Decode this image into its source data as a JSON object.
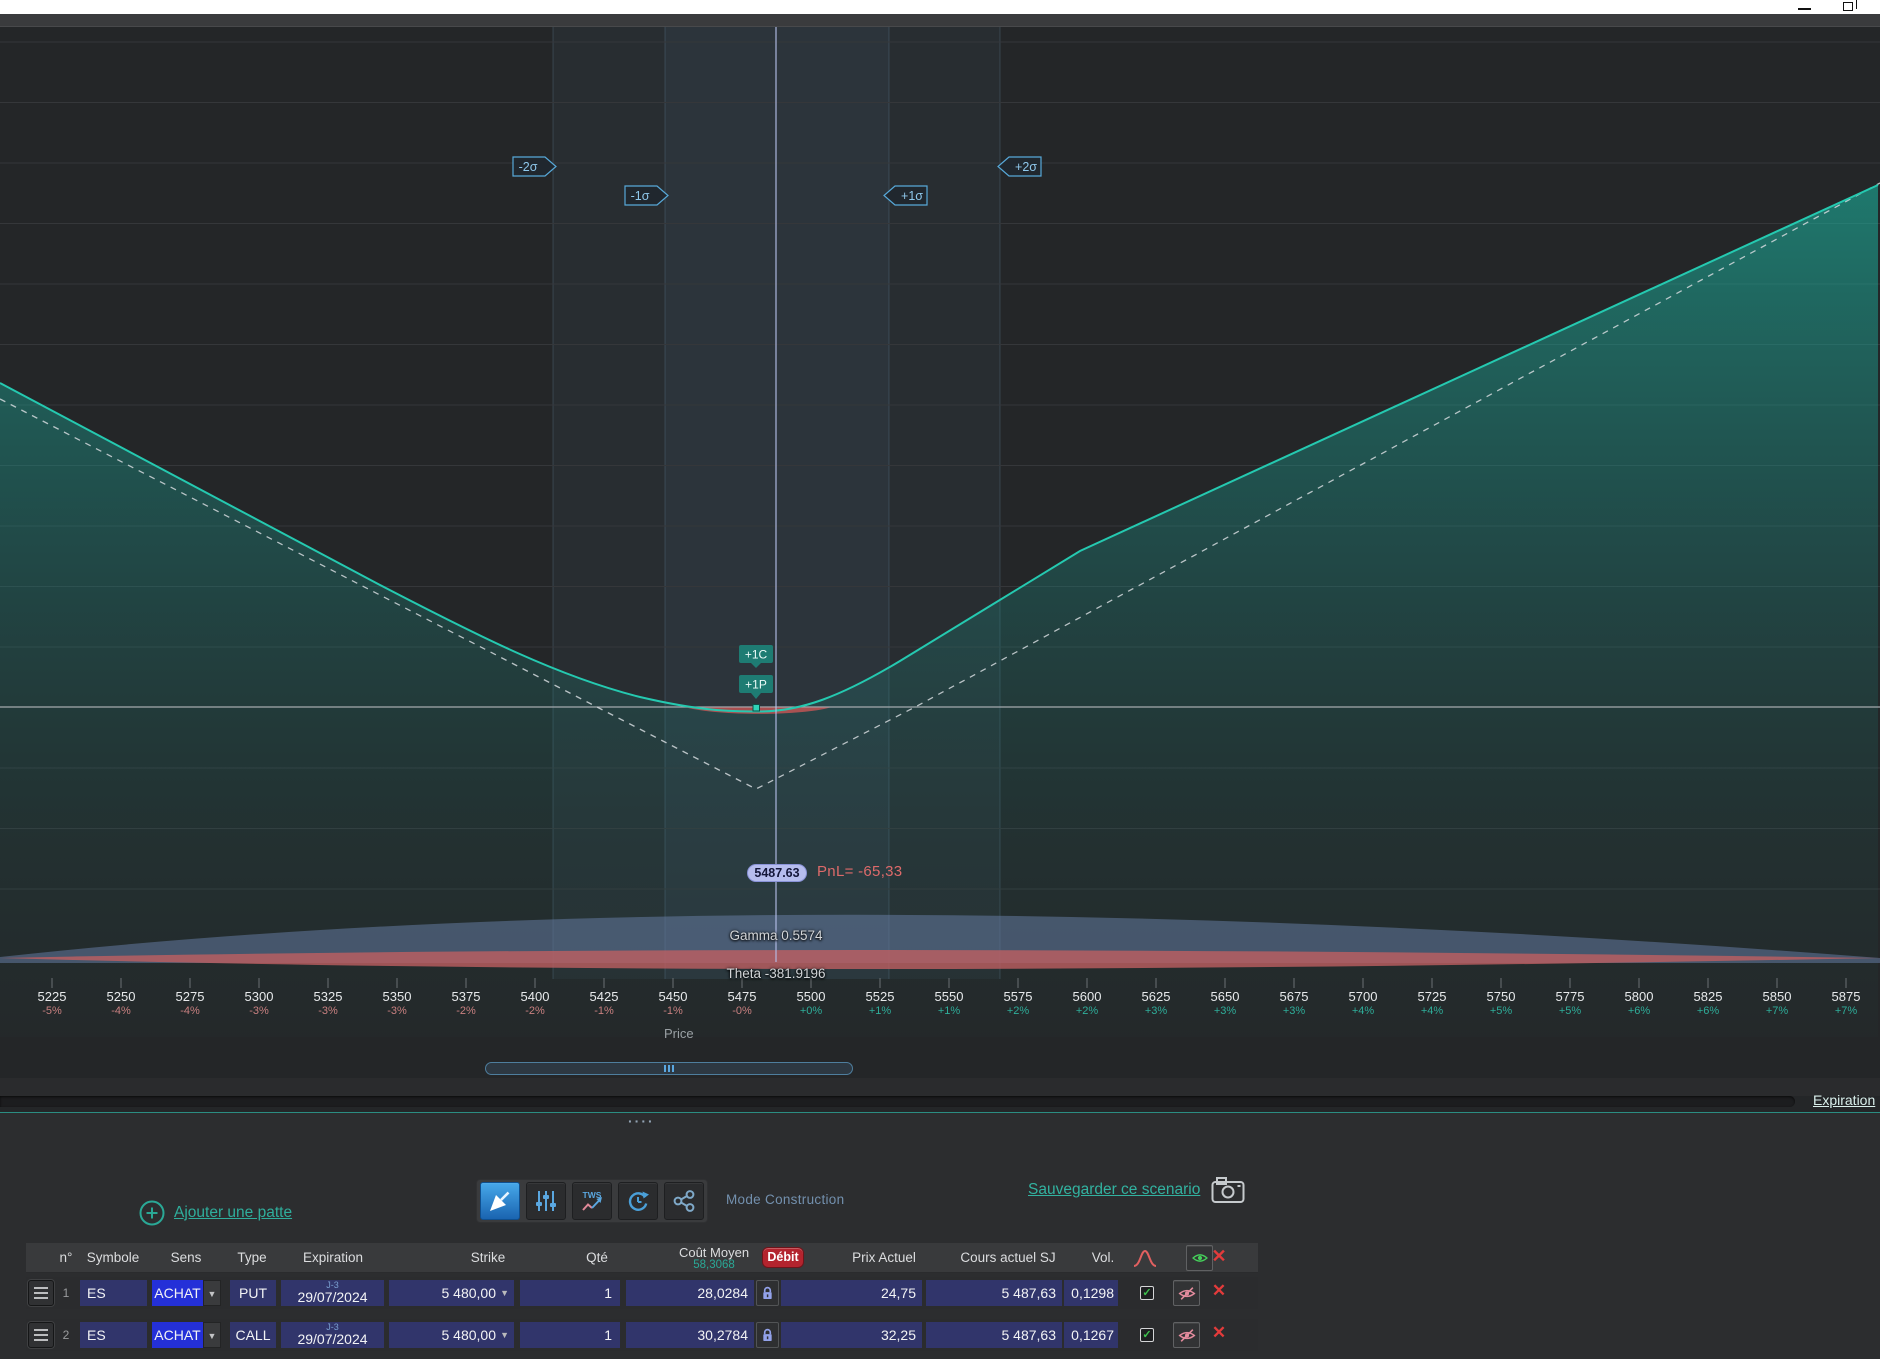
{
  "chart": {
    "sigma_markers": [
      "-2σ",
      "-1σ",
      "+1σ",
      "+2σ"
    ],
    "call_tag": "+1C",
    "put_tag": "+1P",
    "price_pill": "5487.63",
    "pnl_text": "PnL= -65,33",
    "gamma_text": "Gamma 0.5574",
    "theta_text": "Theta -381.9196",
    "axis_title": "Price",
    "ticks": [
      {
        "price": "5225",
        "pct": "-5%"
      },
      {
        "price": "5250",
        "pct": "-4%"
      },
      {
        "price": "5275",
        "pct": "-4%"
      },
      {
        "price": "5300",
        "pct": "-3%"
      },
      {
        "price": "5325",
        "pct": "-3%"
      },
      {
        "price": "5350",
        "pct": "-3%"
      },
      {
        "price": "5375",
        "pct": "-2%"
      },
      {
        "price": "5400",
        "pct": "-2%"
      },
      {
        "price": "5425",
        "pct": "-1%"
      },
      {
        "price": "5450",
        "pct": "-1%"
      },
      {
        "price": "5475",
        "pct": "-0%"
      },
      {
        "price": "5500",
        "pct": "+0%"
      },
      {
        "price": "5525",
        "pct": "+1%"
      },
      {
        "price": "5550",
        "pct": "+1%"
      },
      {
        "price": "5575",
        "pct": "+2%"
      },
      {
        "price": "5600",
        "pct": "+2%"
      },
      {
        "price": "5625",
        "pct": "+3%"
      },
      {
        "price": "5650",
        "pct": "+3%"
      },
      {
        "price": "5675",
        "pct": "+3%"
      },
      {
        "price": "5700",
        "pct": "+4%"
      },
      {
        "price": "5725",
        "pct": "+4%"
      },
      {
        "price": "5750",
        "pct": "+5%"
      },
      {
        "price": "5775",
        "pct": "+5%"
      },
      {
        "price": "5800",
        "pct": "+6%"
      },
      {
        "price": "5825",
        "pct": "+6%"
      },
      {
        "price": "5850",
        "pct": "+7%"
      },
      {
        "price": "5875",
        "pct": "+7%"
      }
    ]
  },
  "splitter": {
    "expiration_link": "Expiration",
    "grip": "····"
  },
  "toolbar": {
    "add_leg_label": "Ajouter une patte",
    "mode_label": "Mode Construction",
    "save_label": "Sauvegarder ce scenario",
    "tws_badge": "TWS"
  },
  "table": {
    "headers": {
      "num": "n°",
      "symbole": "Symbole",
      "sens": "Sens",
      "type": "Type",
      "expiration": "Expiration",
      "strike": "Strike",
      "qte": "Qté",
      "cout_moyen": "Coût Moyen",
      "cout_total": "58,3068",
      "debit_badge": "Débit",
      "prix_actuel": "Prix Actuel",
      "cours_sj": "Cours actuel SJ",
      "vol": "Vol."
    },
    "rows": [
      {
        "num": "1",
        "symbole": "ES",
        "sens": "ACHAT",
        "type": "PUT",
        "dte": "J-3",
        "expiration": "29/07/2024",
        "strike": "5 480,00",
        "qte": "1",
        "cout": "28,0284",
        "prix": "24,75",
        "cours": "5 487,63",
        "vol": "0,1298"
      },
      {
        "num": "2",
        "symbole": "ES",
        "sens": "ACHAT",
        "type": "CALL",
        "dte": "J-3",
        "expiration": "29/07/2024",
        "strike": "5 480,00",
        "qte": "1",
        "cout": "30,2784",
        "prix": "32,25",
        "cours": "5 487,63",
        "vol": "0,1267"
      }
    ]
  },
  "colors": {
    "accent_teal": "#2aa896",
    "curve_teal": "#25c9b0",
    "negative_red": "#dd6a6a",
    "positive_green": "#2fae9a",
    "debit_red": "#b3242e",
    "field_blue": "#31356b",
    "selection_blue": "#2430d8"
  }
}
